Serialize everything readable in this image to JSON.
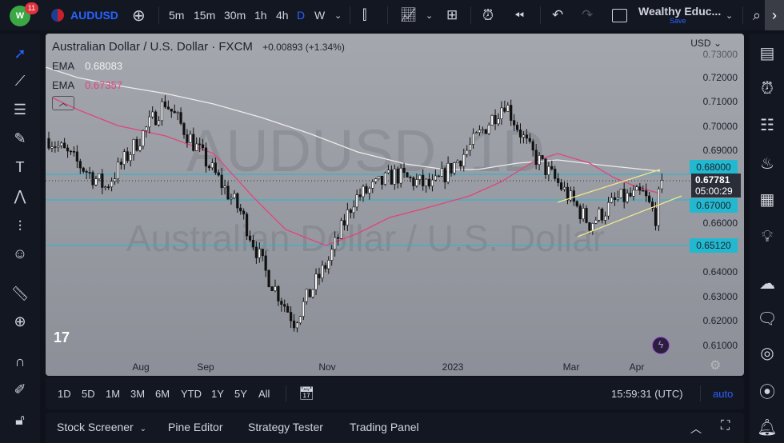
{
  "topbar": {
    "notification_count": "11",
    "symbol": "AUDUSD",
    "intervals": [
      "5m",
      "15m",
      "30m",
      "1h",
      "4h",
      "D",
      "W"
    ],
    "active_interval": "D",
    "layout_name": "Wealthy Educ...",
    "save_label": "Save"
  },
  "chart": {
    "title": "Australian Dollar / U.S. Dollar · FXCM",
    "change": "+0.00893 (+1.34%)",
    "ema1_label": "EMA",
    "ema1_value": "0.68083",
    "ema2_label": "EMA",
    "ema2_value": "0.67357",
    "watermark_symbol": "AUDUSD, 1D",
    "watermark_name": "Australian Dollar / U.S. Dollar",
    "currency": "USD",
    "price_labels": [
      "0.73000",
      "0.72000",
      "0.71000",
      "0.70000",
      "0.69000",
      "0.66000",
      "0.64000",
      "0.63000",
      "0.62000",
      "0.61000"
    ],
    "badges": {
      "level1": "0.68000",
      "level2": "0.67000",
      "level3": "0.65120"
    },
    "current_price": "0.67781",
    "countdown": "05:00:29",
    "time_labels": [
      "Aug",
      "Sep",
      "Nov",
      "2023",
      "Mar",
      "Apr"
    ],
    "colors": {
      "ema_slow": "#e8e8e8",
      "ema_fast": "#e0457b",
      "level": "#22b8cf",
      "channel": "#f0e68c"
    }
  },
  "chart_data": {
    "type": "candlestick",
    "ylim": [
      0.605,
      0.735
    ],
    "anchors_bar_index": [
      0,
      18,
      37,
      53,
      61,
      69,
      78,
      89,
      97,
      110,
      122,
      133,
      145,
      153,
      163,
      172,
      181,
      189,
      193,
      195
    ],
    "anchors_price": [
      0.695,
      0.675,
      0.71,
      0.68,
      0.665,
      0.64,
      0.62,
      0.645,
      0.67,
      0.68,
      0.675,
      0.69,
      0.71,
      0.69,
      0.675,
      0.66,
      0.67,
      0.672,
      0.663,
      0.678
    ],
    "levels": [
      0.68,
      0.67,
      0.6512
    ]
  },
  "bottombar": {
    "ranges": [
      "1D",
      "5D",
      "1M",
      "3M",
      "6M",
      "YTD",
      "1Y",
      "5Y",
      "All"
    ],
    "clock": "15:59:31 (UTC)",
    "auto": "auto"
  },
  "panel": {
    "tabs": [
      "Stock Screener",
      "Pine Editor",
      "Strategy Tester",
      "Trading Panel"
    ]
  }
}
